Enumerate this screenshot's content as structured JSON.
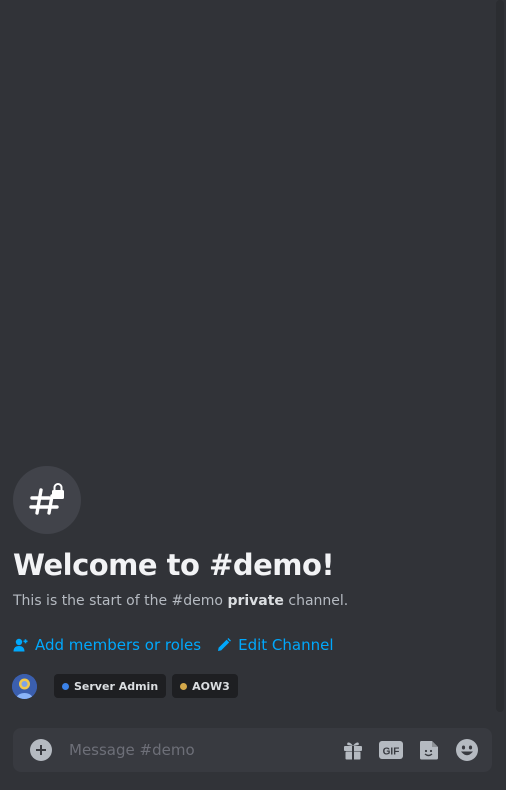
{
  "channel": {
    "name": "demo",
    "privacy": "private"
  },
  "welcome": {
    "title": "Welcome to #demo!",
    "desc_prefix": "This is the start of the #demo ",
    "desc_bold": "private",
    "desc_suffix": " channel.",
    "icon": "hashtag-lock-icon"
  },
  "actions": [
    {
      "label": "Add members or roles",
      "icon": "add-member-icon"
    },
    {
      "label": "Edit Channel",
      "icon": "pencil-icon"
    }
  ],
  "roles": [
    {
      "name": "Server Admin",
      "color": "#3b82e8"
    },
    {
      "name": "AOW3",
      "color": "#d4a84a"
    }
  ],
  "composer": {
    "placeholder": "Message #demo",
    "value": "",
    "tools": [
      "gift-icon",
      "gif-icon",
      "sticker-icon",
      "emoji-icon"
    ]
  },
  "colors": {
    "background": "#313338",
    "link": "#00a8fc",
    "composer": "#383a40"
  }
}
